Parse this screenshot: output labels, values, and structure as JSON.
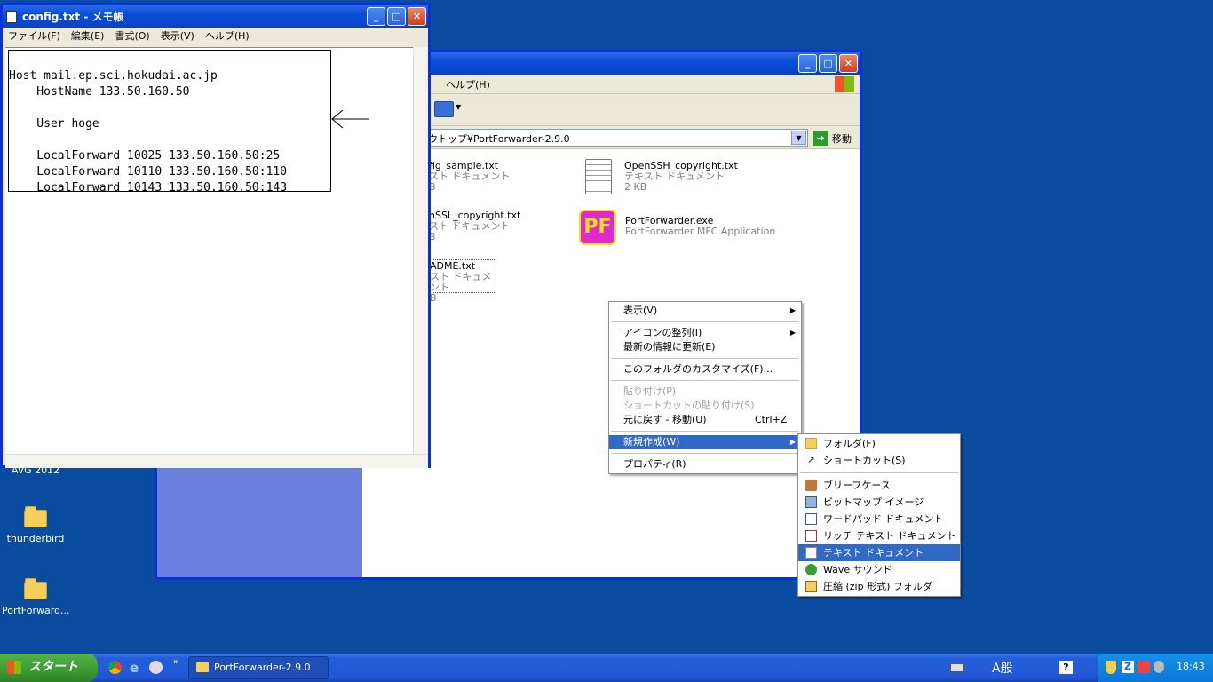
{
  "desktop": {
    "icons": [
      {
        "label": "AVG 2012"
      },
      {
        "label": "thunderbird"
      },
      {
        "label": "PortForward..."
      }
    ]
  },
  "explorer": {
    "menu_help": "ヘルプ(H)",
    "menu_partial": ")",
    "address": "ウトップ¥PortForwarder-2.9.0",
    "go": "移動",
    "files": [
      {
        "name": "fig_sample.txt",
        "type": "スト ドキュメント",
        "size": "B"
      },
      {
        "name": "OpenSSH_copyright.txt",
        "type": "テキスト ドキュメント",
        "size": "2 KB"
      },
      {
        "name": "nSSL_copyright.txt",
        "type": "スト ドキュメント",
        "size": "B"
      },
      {
        "name": "PortForwarder.exe",
        "type": "PortForwarder MFC Application",
        "size": ""
      },
      {
        "name": "ADME.txt",
        "type": "スト ドキュメント",
        "size": "B"
      }
    ]
  },
  "notepad": {
    "title": "config.txt - メモ帳",
    "menu": [
      "ファイル(F)",
      "編集(E)",
      "書式(O)",
      "表示(V)",
      "ヘルプ(H)"
    ],
    "lines": [
      "Host mail.ep.sci.hokudai.ac.jp",
      "    HostName 133.50.160.50",
      "",
      "    User hoge",
      "",
      "    LocalForward 10025 133.50.160.50:25",
      "    LocalForward 10110 133.50.160.50:110",
      "    LocalForward 10143 133.50.160.50:143"
    ]
  },
  "context_menu": {
    "view": "表示(V)",
    "arrange": "アイコンの整列(I)",
    "refresh": "最新の情報に更新(E)",
    "customize": "このフォルダのカスタマイズ(F)...",
    "paste": "貼り付け(P)",
    "paste_shortcut": "ショートカットの貼り付け(S)",
    "undo": "元に戻す - 移動(U)",
    "undo_key": "Ctrl+Z",
    "new": "新規作成(W)",
    "properties": "プロパティ(R)"
  },
  "submenu": {
    "items": [
      "フォルダ(F)",
      "ショートカット(S)",
      "ブリーフケース",
      "ビットマップ イメージ",
      "ワードパッド ドキュメント",
      "リッチ テキスト ドキュメント",
      "テキスト ドキュメント",
      "Wave サウンド",
      "圧縮 (zip 形式) フォルダ"
    ]
  },
  "taskbar": {
    "start": "スタート",
    "task": "PortForwarder-2.9.0",
    "ime": "A般",
    "time": "18:43"
  },
  "colors": {
    "desktop": "#0a4ca0",
    "titlebar": "#0a4dd8",
    "highlight": "#316ac5"
  }
}
